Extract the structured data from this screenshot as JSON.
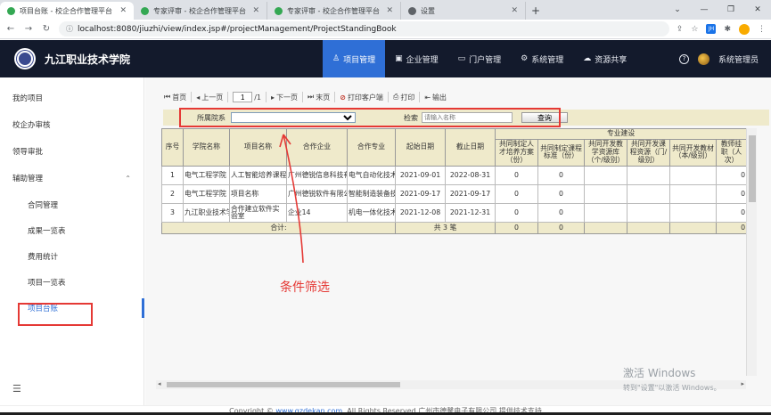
{
  "browser": {
    "tabs": [
      {
        "title": "项目台账 - 校企合作管理平台",
        "active": true,
        "icon": "green-leaf-icon"
      },
      {
        "title": "专家评审 - 校企合作管理平台",
        "active": false,
        "icon": "green-leaf-icon"
      },
      {
        "title": "专家评审 - 校企合作管理平台",
        "active": false,
        "icon": "green-leaf-icon"
      },
      {
        "title": "设置",
        "active": false,
        "icon": "gear-icon"
      }
    ],
    "url": "localhost:8080/jiuzhi/view/index.jsp#/projectManagement/ProjectStandingBook"
  },
  "header": {
    "brand": "九江职业技术学院",
    "nav": [
      {
        "label": "项目管理",
        "icon": "project-icon",
        "active": true
      },
      {
        "label": "企业管理",
        "icon": "enterprise-icon",
        "active": false
      },
      {
        "label": "门户管理",
        "icon": "monitor-icon",
        "active": false
      },
      {
        "label": "系统管理",
        "icon": "gear-icon",
        "active": false
      },
      {
        "label": "资源共享",
        "icon": "cloud-icon",
        "active": false
      }
    ],
    "user": "系统管理员"
  },
  "sidebar": {
    "items": [
      {
        "label": "我的项目",
        "sub": false
      },
      {
        "label": "校企办审核",
        "sub": false
      },
      {
        "label": "领导审批",
        "sub": false
      },
      {
        "label": "辅助管理",
        "sub": false,
        "expanded": true
      },
      {
        "label": "合同管理",
        "sub": true
      },
      {
        "label": "成果一览表",
        "sub": true
      },
      {
        "label": "费用统计",
        "sub": true
      },
      {
        "label": "项目一览表",
        "sub": true
      },
      {
        "label": "项目台账",
        "sub": true,
        "active": true
      }
    ]
  },
  "toolbar": {
    "first": "首页",
    "prev": "上一页",
    "page_value": "1",
    "page_total": "/1",
    "next": "下一页",
    "last": "末页",
    "print_client": "打印客户端",
    "print": "打印",
    "export": "输出"
  },
  "filter": {
    "dept_label": "所属院系",
    "dept_value": "",
    "keyword_label": "检索",
    "keyword_placeholder": "请输入名称",
    "query_button": "查询"
  },
  "table": {
    "group_header": "专业建设",
    "columns": [
      "序号",
      "学院名称",
      "项目名称",
      "合作企业",
      "合作专业",
      "起始日期",
      "截止日期",
      "共同制定人才培养方案（份）",
      "共同制定课程标准（份）",
      "共同开发教学资源库（个/级别）",
      "共同开发课程资源（门/级别）",
      "共同开发教材（本/级别）",
      "教师挂职（人次）"
    ],
    "rows": [
      [
        "1",
        "电气工程学院",
        "人工智能培养课程",
        "广州德锐信息科技有限公司",
        "电气自动化技术",
        "2021-09-01",
        "2022-08-31",
        "0",
        "0",
        "",
        "",
        "",
        "0"
      ],
      [
        "2",
        "电气工程学院",
        "项目名称",
        "广州德锐软件有限公司",
        "智能制造装备技术",
        "2021-09-17",
        "2021-09-17",
        "0",
        "0",
        "",
        "",
        "",
        "0"
      ],
      [
        "3",
        "九江职业技术学院",
        "合作建立软件实验室",
        "企业14",
        "机电一体化技术",
        "2021-12-08",
        "2021-12-31",
        "0",
        "0",
        "",
        "",
        "",
        "0"
      ]
    ],
    "total_label": "合计:",
    "total_count": "共 3 笔",
    "totals": [
      "0",
      "0",
      "",
      "",
      "",
      "0"
    ]
  },
  "annotation": "条件筛选",
  "watermark": {
    "line1": "激活 Windows",
    "line2": "转到\"设置\"以激活 Windows。"
  },
  "footer": {
    "prefix": "Copyright ©",
    "link": "www.gzdekan.com",
    "suffix": ". All Rights Reserved.广州市德馨电子有限公司 提供技术支持"
  },
  "colors": {
    "header_bg": "#131a2c",
    "accent": "#2f6fd6",
    "table_header_bg": "#efeacb",
    "annotation_red": "#e53935"
  }
}
